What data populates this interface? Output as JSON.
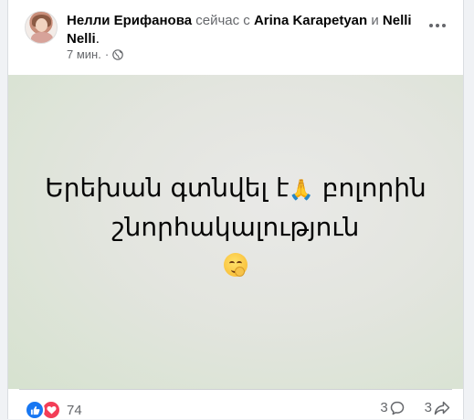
{
  "post": {
    "author": "Нелли Ерифанова",
    "action_text": "сейчас с",
    "tagged_1": "Arina Karapetyan",
    "conjunction": "и",
    "tagged_2": "Nelli",
    "tagged_2_line2": "Nelli",
    "period": ".",
    "time": "7 мин.",
    "separator": "·",
    "privacy_icon": "globe-icon",
    "text_line1_part1": "Երեխան գտնվել է",
    "text_line1_emoji": "🙏",
    "text_line1_part2": " բոլորին",
    "text_line2": "շնորհակալություն",
    "end_emoji": "face-with-hand-over-mouth"
  },
  "footer": {
    "reactions": [
      "like-icon",
      "love-icon"
    ],
    "reaction_count": "74",
    "comments_count": "3",
    "comments_icon": "comment-icon",
    "shares_count": "3",
    "shares_icon": "share-icon"
  },
  "colors": {
    "like": "#1877f2",
    "love": "#f33e58",
    "text_secondary": "#65676b",
    "text_primary": "#050505"
  }
}
